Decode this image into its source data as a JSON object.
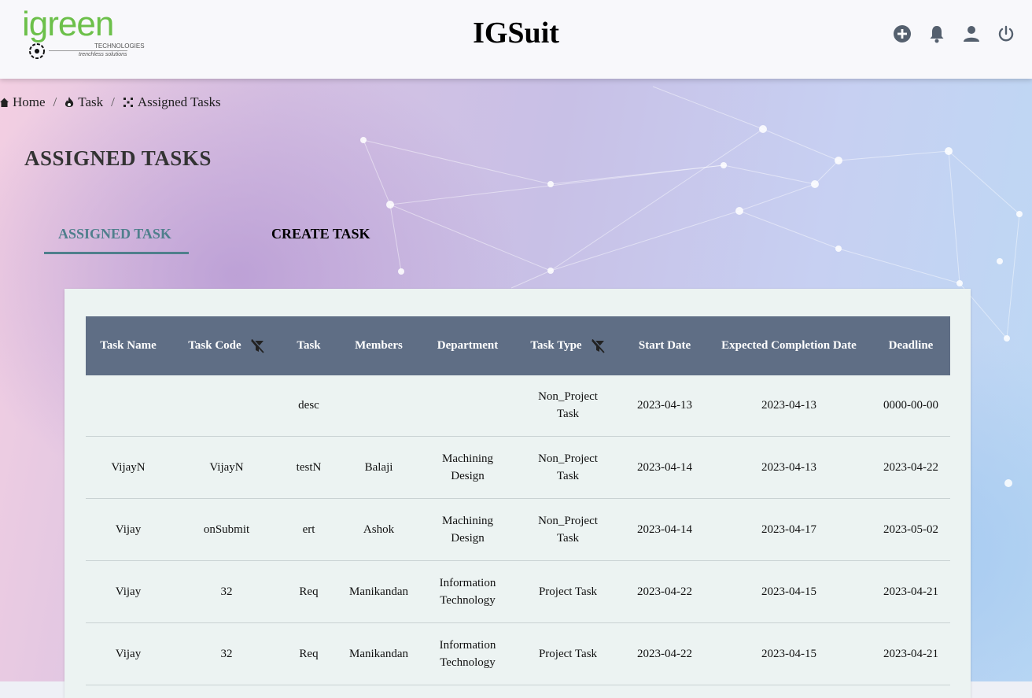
{
  "header": {
    "logo": {
      "word": "igreen",
      "line1": "TECHNOLOGIES",
      "line2": "trenchless solutions"
    },
    "app_title": "IGSuit",
    "icons": [
      "add-circle-icon",
      "bell-icon",
      "user-icon",
      "power-icon"
    ]
  },
  "breadcrumb": {
    "items": [
      {
        "label": "Home",
        "icon": "home-icon"
      },
      {
        "label": "Task",
        "icon": "fire-icon"
      },
      {
        "label": "Assigned Tasks",
        "icon": "grid-dots-icon"
      }
    ],
    "separator": "/"
  },
  "page": {
    "title": "ASSIGNED TASKS"
  },
  "tabs": {
    "assigned": "ASSIGNED TASK",
    "create": "CREATE TASK",
    "active": "assigned",
    "accent": "#4f7f8c"
  },
  "table": {
    "header_bg": "#5f6e85",
    "columns": [
      "Task Name",
      "Task Code",
      "Task",
      "Members",
      "Department",
      "Task Type",
      "Start Date",
      "Expected Completion Date",
      "Deadline"
    ],
    "filterable": [
      "Task Code",
      "Task Type"
    ],
    "rows": [
      [
        "",
        "",
        "desc",
        "",
        "",
        "Non_Project Task",
        "2023-04-13",
        "2023-04-13",
        "0000-00-00"
      ],
      [
        "VijayN",
        "VijayN",
        "testN",
        "Balaji",
        "Machining Design",
        "Non_Project Task",
        "2023-04-14",
        "2023-04-13",
        "2023-04-22"
      ],
      [
        "Vijay",
        "onSubmit",
        "ert",
        "Ashok",
        "Machining Design",
        "Non_Project Task",
        "2023-04-14",
        "2023-04-17",
        "2023-05-02"
      ],
      [
        "Vijay",
        "32",
        "Req",
        "Manikandan",
        "Information Technology",
        "Project Task",
        "2023-04-22",
        "2023-04-15",
        "2023-04-21"
      ],
      [
        "Vijay",
        "32",
        "Req",
        "Manikandan",
        "Information Technology",
        "Project Task",
        "2023-04-22",
        "2023-04-15",
        "2023-04-21"
      ]
    ]
  }
}
